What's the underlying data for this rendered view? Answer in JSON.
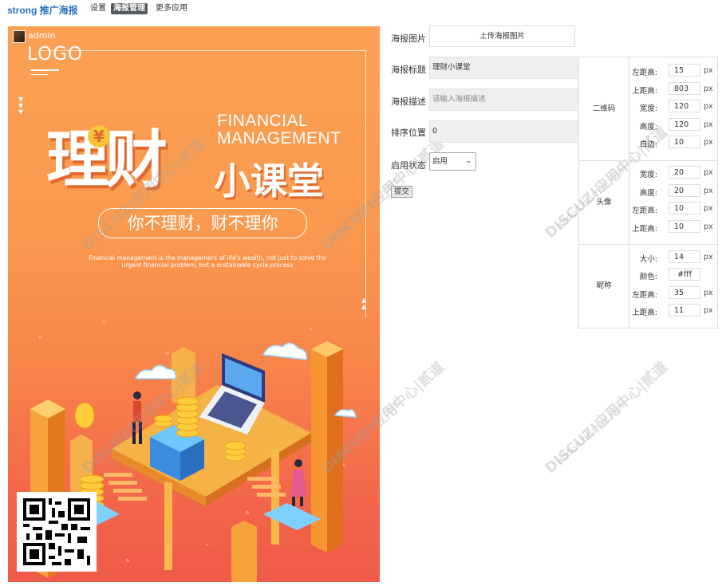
{
  "nav": {
    "brand": "strong 推广海报",
    "tabs": [
      {
        "label": "设置",
        "active": false
      },
      {
        "label": "海报管理",
        "active": true
      },
      {
        "label": "更多应用",
        "active": false
      }
    ]
  },
  "poster": {
    "admin_name": "admin",
    "logo_text": "LOGO",
    "title_part1": "理财",
    "title_part2": "小课堂",
    "yen_symbol": "¥",
    "english_title_line1": "FINANCIAL",
    "english_title_line2": "MANAGEMENT",
    "slogan": "你不理财，财不理你",
    "english_desc_line1": "Financial management is the management of life's wealth, not just to solve the",
    "english_desc_line2": "urgent financial problem, but a sustainable cycle process"
  },
  "form": {
    "image_label": "海报图片",
    "upload_button": "上传海报图片",
    "title_label": "海报标题",
    "title_value": "理财小课堂",
    "desc_label": "海报描述",
    "desc_placeholder": "请输入海报描述",
    "order_label": "排序位置",
    "order_value": "0",
    "status_label": "启用状态",
    "status_value": "启用",
    "submit_label": "提交"
  },
  "settings": {
    "unit": "px",
    "qrcode": {
      "name": "二维码",
      "rows": [
        {
          "key": "左距高:",
          "value": "15",
          "unit": "px"
        },
        {
          "key": "上距高:",
          "value": "803",
          "unit": "px"
        },
        {
          "key": "宽度:",
          "value": "120",
          "unit": "px"
        },
        {
          "key": "高度:",
          "value": "120",
          "unit": "px"
        },
        {
          "key": "白边:",
          "value": "10",
          "unit": "px"
        }
      ]
    },
    "avatar": {
      "name": "头像",
      "rows": [
        {
          "key": "宽度:",
          "value": "20",
          "unit": "px"
        },
        {
          "key": "高度:",
          "value": "20",
          "unit": "px"
        },
        {
          "key": "左距高:",
          "value": "10",
          "unit": "px"
        },
        {
          "key": "上距高:",
          "value": "10",
          "unit": "px"
        }
      ]
    },
    "nickname": {
      "name": "昵称",
      "rows": [
        {
          "key": "大小:",
          "value": "14",
          "unit": "px"
        },
        {
          "key": "颜色:",
          "value": "#fff",
          "unit": ""
        },
        {
          "key": "左距高:",
          "value": "35",
          "unit": "px"
        },
        {
          "key": "上距高:",
          "value": "11",
          "unit": "px"
        }
      ]
    }
  },
  "watermark": {
    "text": "DISCUZ!应用中心|贰道",
    "sub": "addon.dismall.com"
  },
  "colors": {
    "poster_top": "#fba052",
    "poster_bottom": "#ef5a48",
    "brand": "#2a75c4",
    "active_tab": "#555a60"
  }
}
